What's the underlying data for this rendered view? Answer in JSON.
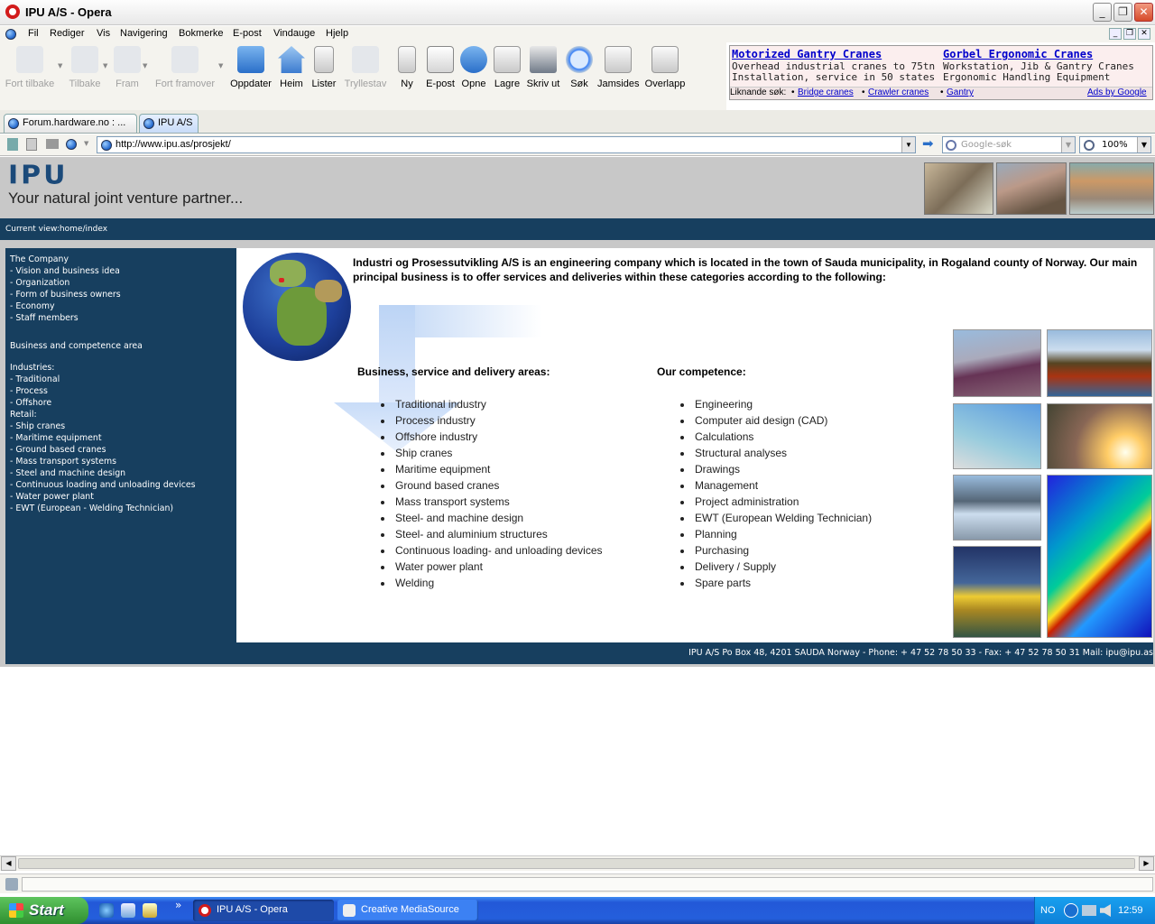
{
  "window": {
    "title": "IPU A/S - Opera"
  },
  "menu": [
    "Fil",
    "Rediger",
    "Vis",
    "Navigering",
    "Bokmerke",
    "E-post",
    "Vindauge",
    "Hjelp"
  ],
  "toolbar": [
    {
      "label": "Fort tilbake",
      "icon": "fast-back-icon",
      "enabled": false
    },
    {
      "label": "Tilbake",
      "icon": "back-icon",
      "enabled": false
    },
    {
      "label": "Fram",
      "icon": "forward-icon",
      "enabled": false
    },
    {
      "label": "Fort framover",
      "icon": "fast-forward-icon",
      "enabled": false
    },
    {
      "label": "Oppdater",
      "icon": "reload-icon",
      "enabled": true
    },
    {
      "label": "Heim",
      "icon": "home-icon",
      "enabled": true
    },
    {
      "label": "Lister",
      "icon": "lists-icon",
      "enabled": true
    },
    {
      "label": "Tryllestav",
      "icon": "wand-icon",
      "enabled": false
    },
    {
      "label": "Ny",
      "icon": "new-page-icon",
      "enabled": true
    },
    {
      "label": "E-post",
      "icon": "mail-icon",
      "enabled": true
    },
    {
      "label": "Opne",
      "icon": "open-icon",
      "enabled": true
    },
    {
      "label": "Lagre",
      "icon": "save-icon",
      "enabled": true
    },
    {
      "label": "Skriv ut",
      "icon": "print-icon",
      "enabled": true
    },
    {
      "label": "Søk",
      "icon": "search-icon",
      "enabled": true
    },
    {
      "label": "Jamsides",
      "icon": "tile-icon",
      "enabled": true
    },
    {
      "label": "Overlapp",
      "icon": "cascade-icon",
      "enabled": true
    }
  ],
  "ads": {
    "ad1_title": "Motorized Gantry Cranes",
    "ad1_line1": "Overhead industrial cranes to 75tn",
    "ad1_line2": "Installation, service in 50 states",
    "ad2_title": "Gorbel Ergonomic Cranes",
    "ad2_line1": "Workstation, Jib & Gantry Cranes",
    "ad2_line2": "Ergonomic Handling Equipment",
    "similar_label": "Liknande søk:",
    "similar_links": [
      "Bridge cranes",
      "Crawler cranes",
      "Gantry"
    ],
    "bullet": "•",
    "ads_by": "Ads by Google"
  },
  "tabs": [
    {
      "label": "Forum.hardware.no : ...",
      "active": false
    },
    {
      "label": "IPU A/S",
      "active": true
    }
  ],
  "address": {
    "url": "http://www.ipu.as/prosjekt/",
    "search_placeholder": "Google-søk",
    "zoom": "100%"
  },
  "page": {
    "logo": "IPU",
    "slogan": "Your natural joint venture partner...",
    "current_view": "Current view:home/index",
    "sidebar": [
      "The Company",
      "- Vision and business idea",
      "- Organization",
      "- Form of business owners",
      "- Economy",
      "- Staff members",
      "Business and competence area",
      "Industries:",
      "- Traditional",
      "- Process",
      "- Offshore",
      "Retail:",
      "- Ship cranes",
      "- Maritime equipment",
      "- Ground based cranes",
      "- Mass transport systems",
      "- Steel and machine design",
      "- Continuous loading and unloading devices",
      "- Water power plant",
      "- EWT (European - Welding Technician)"
    ],
    "intro": "Industri og Prosessutvikling A/S is an engineering company which is located in the town of Sauda municipality, in Rogaland county of Norway. Our main principal business is to offer services and deliveries within these categories according to the following:",
    "services_heading": "Business, service and delivery areas:",
    "services": [
      "Traditional industry",
      "Process industry",
      "Offshore industry",
      "Ship cranes",
      "Maritime equipment",
      "Ground based cranes",
      "Mass transport systems",
      "Steel- and machine design",
      "Steel- and aluminium structures",
      "Continuous loading- and unloading devices",
      "Water power plant",
      "Welding"
    ],
    "competence_heading": "Our competence:",
    "competence": [
      "Engineering",
      "Computer aid design (CAD)",
      "Calculations",
      "Structural analyses",
      "Drawings",
      "Management",
      "Project administration",
      "EWT (European Welding Technician)",
      "Planning",
      "Purchasing",
      "Delivery / Supply",
      "Spare parts"
    ],
    "footer": "IPU A/S Po Box 48, 4201 SAUDA Norway - Phone: + 47 52 78 50 33 - Fax: + 47 52 78 50 31 Mail: ipu@ipu.as"
  },
  "taskbar": {
    "start": "Start",
    "tasks": [
      {
        "label": "IPU A/S - Opera",
        "active": true
      },
      {
        "label": "Creative MediaSource",
        "active": false
      }
    ],
    "lang": "NO",
    "clock": "12:59",
    "overflow": "»"
  },
  "colors": {
    "site_navy": "#173f5f",
    "site_grey": "#c8c8c8",
    "link_blue": "#0000cc",
    "xp_blue": "#245fdc"
  }
}
